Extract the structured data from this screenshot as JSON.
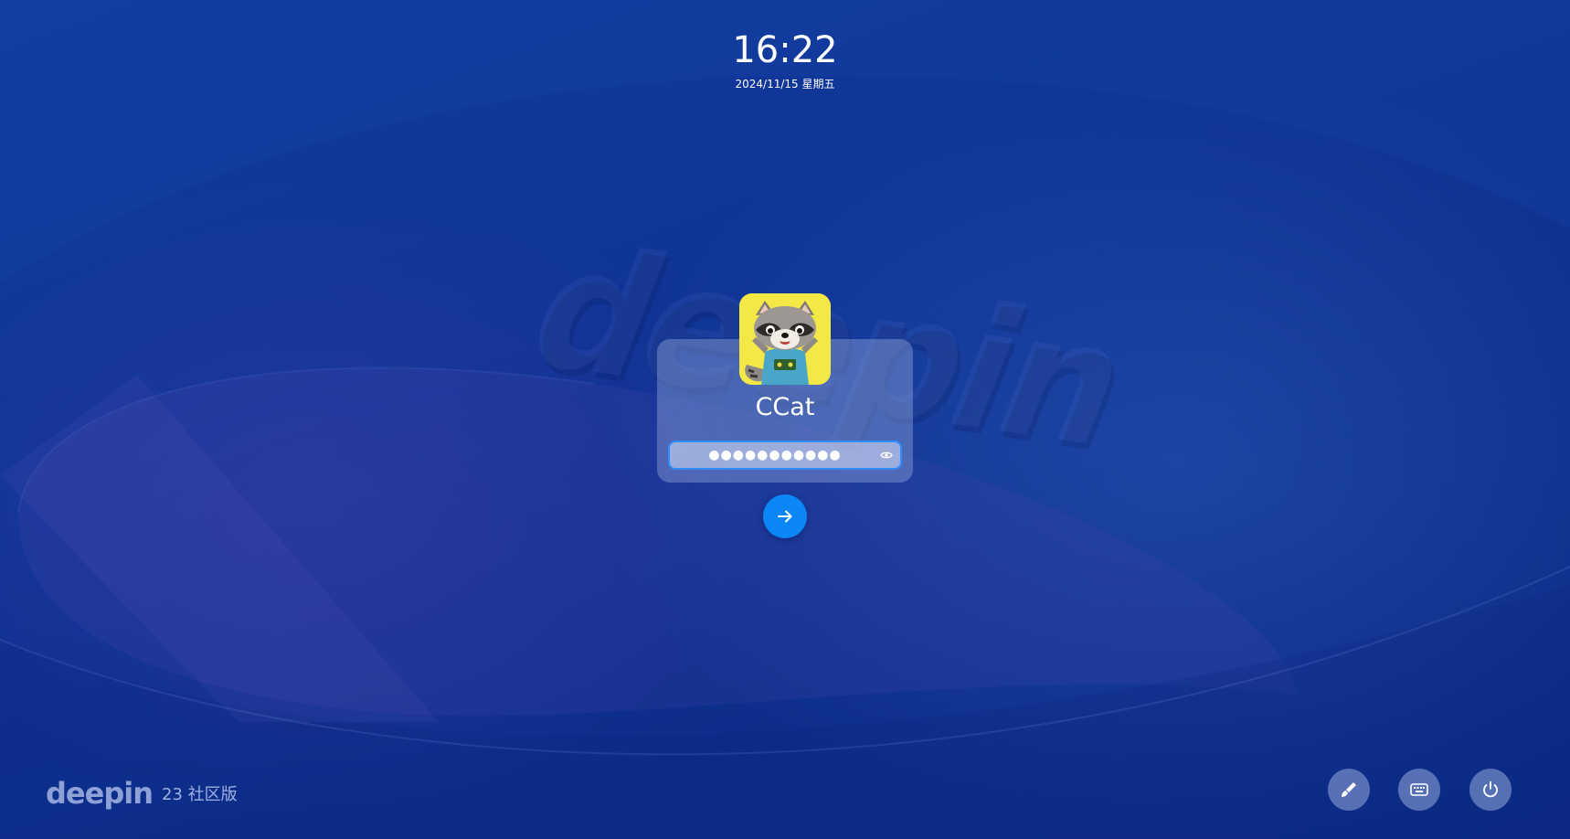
{
  "clock": {
    "time": "16:22",
    "date": "2024/11/15 星期五"
  },
  "background": {
    "watermark_text": "deepin",
    "colors": {
      "base": "#0f3597",
      "accent": "#0a86f5",
      "field_border": "#2f8cff"
    }
  },
  "login": {
    "avatar_icon": "raccoon-avatar",
    "username": "CCat",
    "password_mask": "●●●●●●●●●●●",
    "reveal_icon": "eye-icon",
    "submit_icon": "arrow-right-icon"
  },
  "footer": {
    "brand_logo": "deepin",
    "brand_version": "23 社区版",
    "buttons": [
      {
        "name": "theme-button",
        "icon": "brush-icon"
      },
      {
        "name": "keyboard-button",
        "icon": "keyboard-icon"
      },
      {
        "name": "power-button",
        "icon": "power-icon"
      }
    ]
  }
}
